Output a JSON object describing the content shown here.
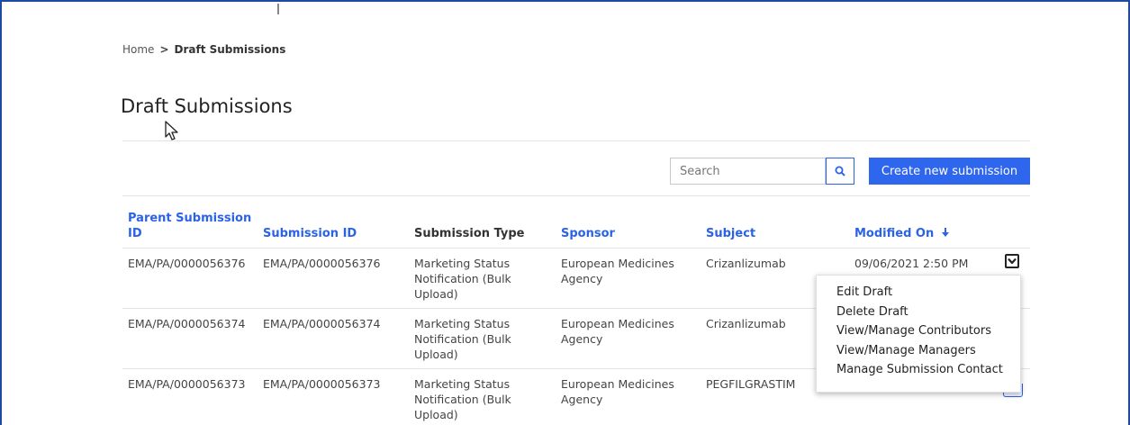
{
  "breadcrumb": {
    "home": "Home",
    "separator": ">",
    "current": "Draft Submissions"
  },
  "page": {
    "title": "Draft Submissions"
  },
  "toolbar": {
    "search_placeholder": "Search",
    "search_icon": "search-icon",
    "create_label": "Create new submission"
  },
  "table": {
    "headers": {
      "parent_id": "Parent Submission ID",
      "submission_id": "Submission ID",
      "type": "Submission Type",
      "sponsor": "Sponsor",
      "subject": "Subject",
      "modified": "Modified On",
      "sort_icon": "arrow-down-icon"
    },
    "rows": [
      {
        "parent_id": "EMA/PA/0000056376",
        "submission_id": "EMA/PA/0000056376",
        "type": [
          "Marketing Status",
          "Notification (Bulk",
          "Upload)"
        ],
        "sponsor": [
          "European Medicines",
          "Agency"
        ],
        "subject": "Crizanlizumab",
        "modified": "09/06/2021 2:50 PM"
      },
      {
        "parent_id": "EMA/PA/0000056374",
        "submission_id": "EMA/PA/0000056374",
        "type": [
          "Marketing Status",
          "Notification (Bulk",
          "Upload)"
        ],
        "sponsor": [
          "European Medicines",
          "Agency"
        ],
        "subject": "Crizanlizumab",
        "modified": ""
      },
      {
        "parent_id": "EMA/PA/0000056373",
        "submission_id": "EMA/PA/0000056373",
        "type": [
          "Marketing Status",
          "Notification (Bulk",
          "Upload)"
        ],
        "sponsor": [
          "European Medicines",
          "Agency"
        ],
        "subject": "PEGFILGRASTIM",
        "modified": ""
      }
    ]
  },
  "action_menu": {
    "items": [
      "Edit Draft",
      "Delete Draft",
      "View/Manage Contributors",
      "View/Manage Managers",
      "Manage Submission Contact"
    ]
  },
  "colors": {
    "accent": "#2e66ee",
    "link": "#2b63e8",
    "frame": "#1e4aa3"
  }
}
